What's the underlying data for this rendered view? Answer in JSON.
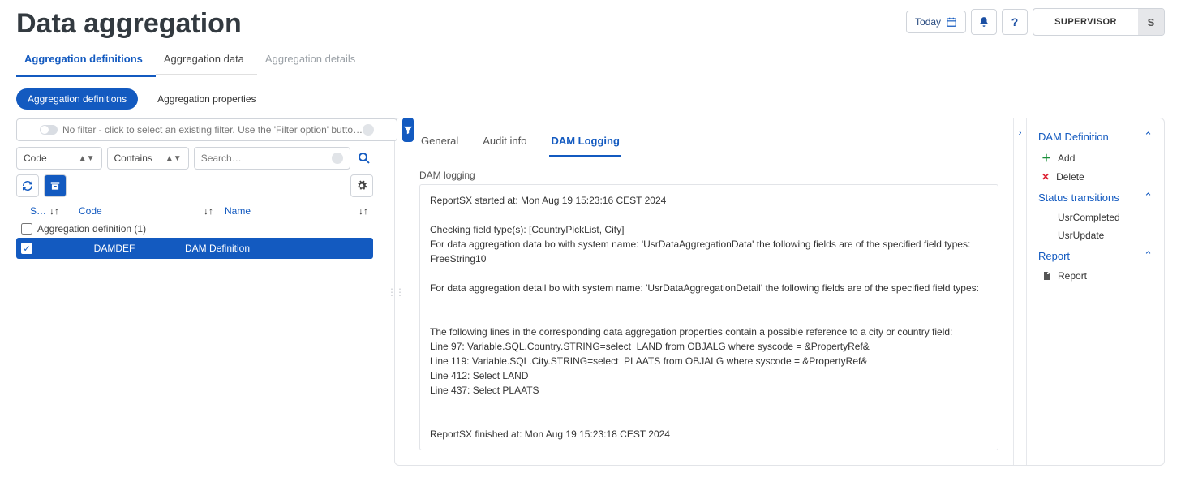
{
  "header": {
    "title": "Data aggregation",
    "today_label": "Today",
    "user_label": "SUPERVISOR",
    "user_initial": "S"
  },
  "primary_tabs": {
    "t0": "Aggregation definitions",
    "t1": "Aggregation data",
    "t2": "Aggregation details"
  },
  "pill_tabs": {
    "p0": "Aggregation definitions",
    "p1": "Aggregation properties"
  },
  "filter": {
    "placeholder": "No filter - click to select an existing filter. Use the 'Filter option' butto…"
  },
  "search": {
    "field_label": "Code",
    "op_label": "Contains",
    "placeholder": "Search…"
  },
  "columns": {
    "short": "S…",
    "code": "Code",
    "name": "Name"
  },
  "list": {
    "group_label": "Aggregation definition (1)",
    "row_code": "DAMDEF",
    "row_name": "DAM Definition"
  },
  "detail_tabs": {
    "d0": "General",
    "d1": "Audit info",
    "d2": "DAM Logging"
  },
  "dam": {
    "section_label": "DAM logging",
    "log": "ReportSX started at: Mon Aug 19 15:23:16 CEST 2024\n\nChecking field type(s): [CountryPickList, City]\nFor data aggregation data bo with system name: 'UsrDataAggregationData' the following fields are of the specified field types:\nFreeString10\n\nFor data aggregation detail bo with system name: 'UsrDataAggregationDetail' the following fields are of the specified field types:\n\n\nThe following lines in the corresponding data aggregation properties contain a possible reference to a city or country field:\nLine 97: Variable.SQL.Country.STRING=select  LAND from OBJALG where syscode = &PropertyRef&\nLine 119: Variable.SQL.City.STRING=select  PLAATS from OBJALG where syscode = &PropertyRef&\nLine 412: Select LAND\nLine 437: Select PLAATS\n\n\nReportSX finished at: Mon Aug 19 15:23:18 CEST 2024"
  },
  "side": {
    "s0": "DAM Definition",
    "add": "Add",
    "delete": "Delete",
    "s1": "Status transitions",
    "usr_completed": "UsrCompleted",
    "usr_update": "UsrUpdate",
    "s2": "Report",
    "report": "Report"
  }
}
